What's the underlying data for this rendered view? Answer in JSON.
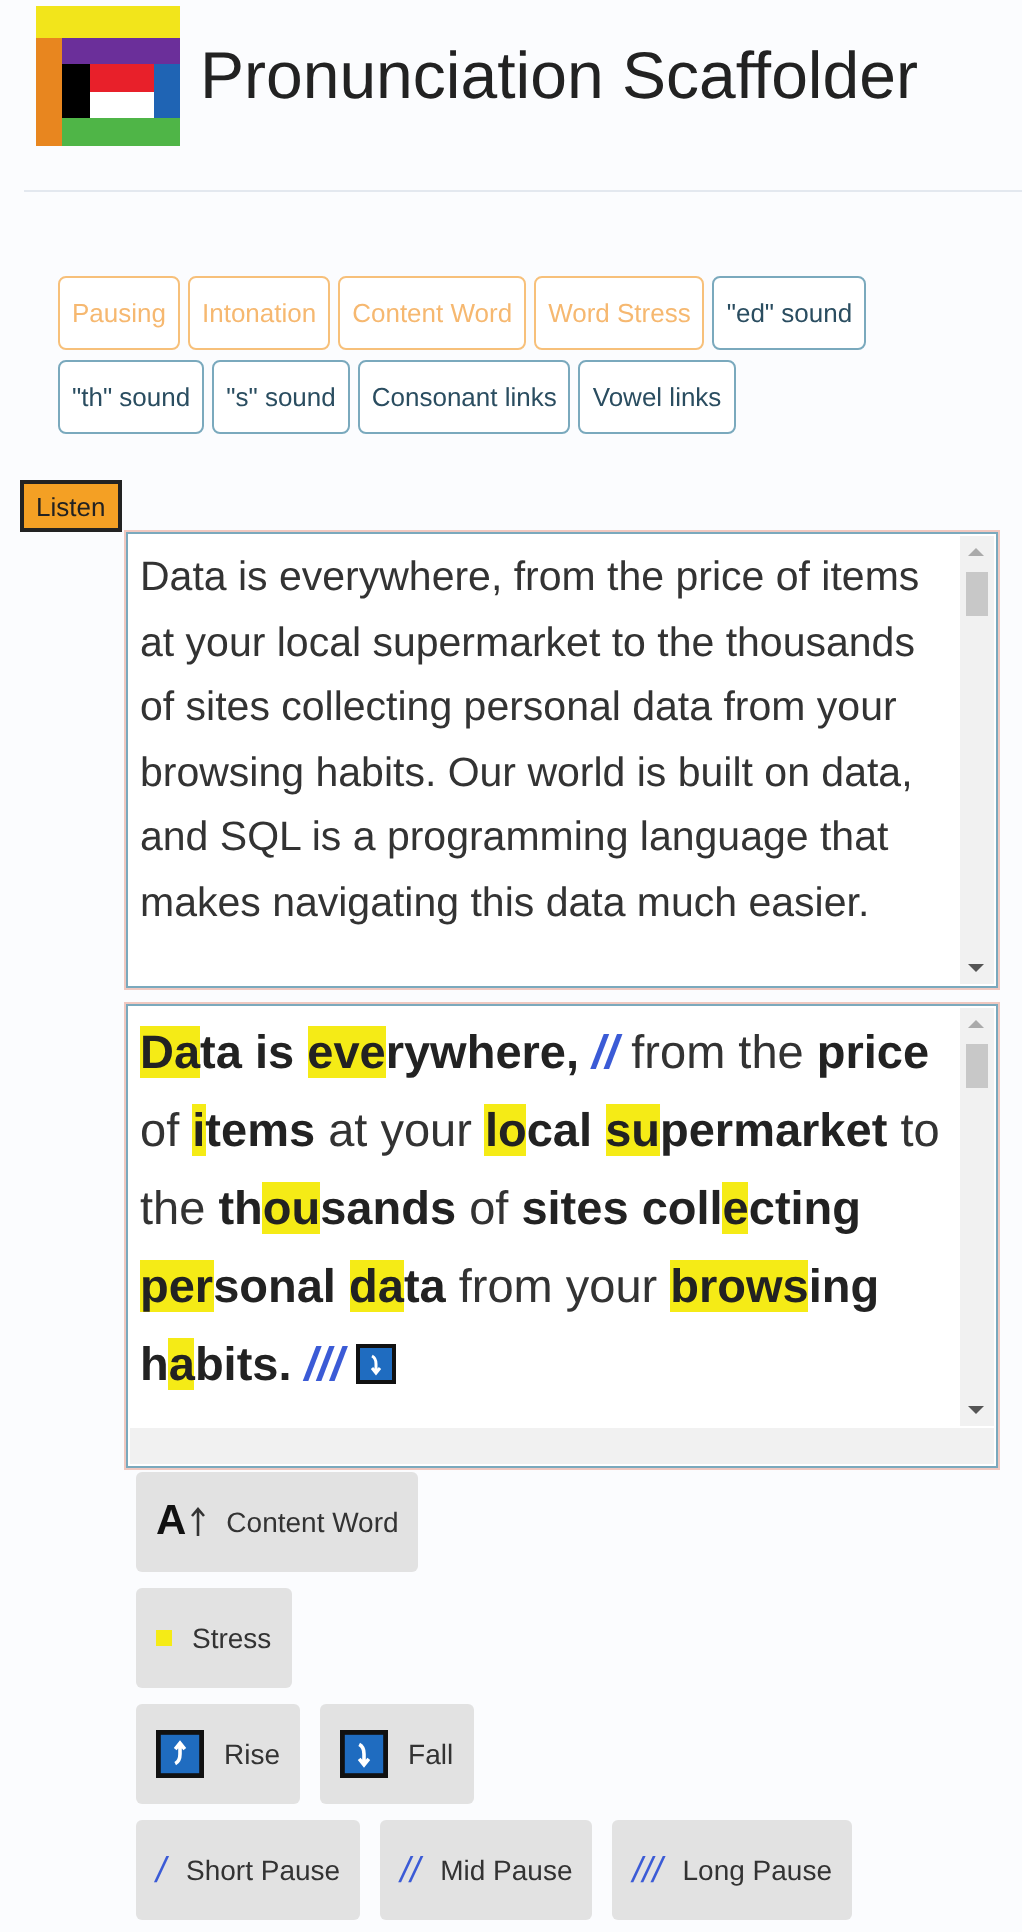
{
  "app": {
    "title": "Pronunciation Scaffolder"
  },
  "tabs": [
    {
      "label": "Pausing",
      "selected": true
    },
    {
      "label": "Intonation",
      "selected": true
    },
    {
      "label": "Content Word",
      "selected": true
    },
    {
      "label": "Word Stress",
      "selected": true
    },
    {
      "label": "\"ed\" sound",
      "selected": false
    },
    {
      "label": "\"th\" sound",
      "selected": false
    },
    {
      "label": "\"s\" sound",
      "selected": false
    },
    {
      "label": "Consonant links",
      "selected": false
    },
    {
      "label": "Vowel links",
      "selected": false
    }
  ],
  "listen_button": "Listen",
  "input_text": "Data is everywhere, from the price of items at your local supermarket to the thousands of sites collecting personal data from your browsing habits. Our world is built on data, and SQL is a programming language that makes navigating this data much easier.",
  "annotated": [
    {
      "kind": "word",
      "content": true,
      "parts": [
        {
          "text": "Da",
          "stress": true
        },
        {
          "text": "ta",
          "stress": false
        }
      ]
    },
    {
      "kind": "word",
      "content": true,
      "parts": [
        {
          "text": "is",
          "stress": false
        }
      ]
    },
    {
      "kind": "word",
      "content": true,
      "parts": [
        {
          "text": "eve",
          "stress": true
        },
        {
          "text": "rywhere,",
          "stress": false
        }
      ]
    },
    {
      "kind": "pause",
      "text": "//"
    },
    {
      "kind": "word",
      "content": false,
      "parts": [
        {
          "text": "from",
          "stress": false
        }
      ]
    },
    {
      "kind": "word",
      "content": false,
      "parts": [
        {
          "text": "the",
          "stress": false
        }
      ]
    },
    {
      "kind": "word",
      "content": true,
      "parts": [
        {
          "text": "price",
          "stress": false
        }
      ]
    },
    {
      "kind": "word",
      "content": false,
      "parts": [
        {
          "text": "of",
          "stress": false
        }
      ]
    },
    {
      "kind": "word",
      "content": true,
      "parts": [
        {
          "text": "i",
          "stress": true
        },
        {
          "text": "tems",
          "stress": false
        }
      ]
    },
    {
      "kind": "word",
      "content": false,
      "parts": [
        {
          "text": "at",
          "stress": false
        }
      ]
    },
    {
      "kind": "word",
      "content": false,
      "parts": [
        {
          "text": "your",
          "stress": false
        }
      ]
    },
    {
      "kind": "word",
      "content": true,
      "parts": [
        {
          "text": "lo",
          "stress": true
        },
        {
          "text": "cal",
          "stress": false
        }
      ]
    },
    {
      "kind": "word",
      "content": true,
      "parts": [
        {
          "text": "su",
          "stress": true
        },
        {
          "text": "permarket",
          "stress": false
        }
      ]
    },
    {
      "kind": "word",
      "content": false,
      "parts": [
        {
          "text": "to",
          "stress": false
        }
      ]
    },
    {
      "kind": "word",
      "content": false,
      "parts": [
        {
          "text": "the",
          "stress": false
        }
      ]
    },
    {
      "kind": "word",
      "content": true,
      "parts": [
        {
          "text": "th",
          "stress": false
        },
        {
          "text": "ou",
          "stress": true
        },
        {
          "text": "sands",
          "stress": false
        }
      ]
    },
    {
      "kind": "word",
      "content": false,
      "parts": [
        {
          "text": "of",
          "stress": false
        }
      ]
    },
    {
      "kind": "word",
      "content": true,
      "parts": [
        {
          "text": "sites",
          "stress": false
        }
      ]
    },
    {
      "kind": "word",
      "content": true,
      "parts": [
        {
          "text": "coll",
          "stress": false
        },
        {
          "text": "e",
          "stress": true
        },
        {
          "text": "cting",
          "stress": false
        }
      ]
    },
    {
      "kind": "word",
      "content": true,
      "parts": [
        {
          "text": "per",
          "stress": true
        },
        {
          "text": "sonal",
          "stress": false
        }
      ]
    },
    {
      "kind": "word",
      "content": true,
      "parts": [
        {
          "text": "da",
          "stress": true
        },
        {
          "text": "ta",
          "stress": false
        }
      ]
    },
    {
      "kind": "word",
      "content": false,
      "parts": [
        {
          "text": "from",
          "stress": false
        }
      ]
    },
    {
      "kind": "word",
      "content": false,
      "parts": [
        {
          "text": "your",
          "stress": false
        }
      ]
    },
    {
      "kind": "word",
      "content": true,
      "parts": [
        {
          "text": "brows",
          "stress": true
        },
        {
          "text": "ing",
          "stress": false
        }
      ]
    },
    {
      "kind": "word",
      "content": true,
      "parts": [
        {
          "text": "h",
          "stress": false
        },
        {
          "text": "a",
          "stress": true
        },
        {
          "text": "bits.",
          "stress": false
        }
      ]
    },
    {
      "kind": "pause",
      "text": "///"
    },
    {
      "kind": "fall"
    }
  ],
  "legend": [
    [
      {
        "kind": "content",
        "symbol": "A",
        "label": "Content Word"
      }
    ],
    [
      {
        "kind": "stress",
        "label": "Stress"
      }
    ],
    [
      {
        "kind": "rise",
        "label": "Rise"
      },
      {
        "kind": "fall",
        "label": "Fall"
      }
    ],
    [
      {
        "kind": "pause",
        "symbol": "/",
        "label": "Short Pause"
      },
      {
        "kind": "pause",
        "symbol": "//",
        "label": "Mid Pause"
      },
      {
        "kind": "pause",
        "symbol": "///",
        "label": "Long Pause"
      }
    ]
  ]
}
